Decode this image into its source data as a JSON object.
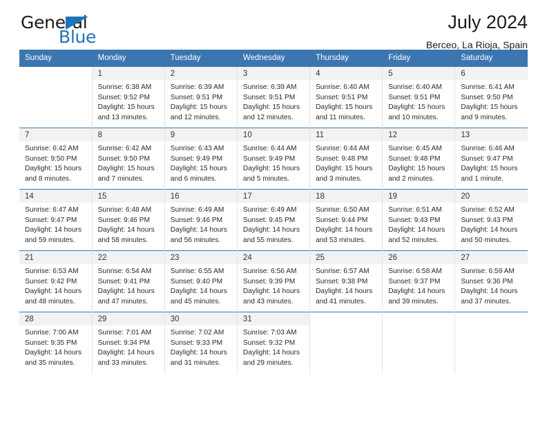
{
  "brand": {
    "name_part1": "General",
    "name_part2": "Blue",
    "accent_color": "#1e74bb"
  },
  "header": {
    "title": "July 2024",
    "subtitle": "Berceo, La Rioja, Spain"
  },
  "calendar": {
    "header_color": "#3b76b0",
    "weekday_headers": [
      "Sunday",
      "Monday",
      "Tuesday",
      "Wednesday",
      "Thursday",
      "Friday",
      "Saturday"
    ],
    "weeks": [
      [
        {
          "day": "",
          "lines": []
        },
        {
          "day": "1",
          "lines": [
            "Sunrise: 6:38 AM",
            "Sunset: 9:52 PM",
            "Daylight: 15 hours",
            "and 13 minutes."
          ]
        },
        {
          "day": "2",
          "lines": [
            "Sunrise: 6:39 AM",
            "Sunset: 9:51 PM",
            "Daylight: 15 hours",
            "and 12 minutes."
          ]
        },
        {
          "day": "3",
          "lines": [
            "Sunrise: 6:39 AM",
            "Sunset: 9:51 PM",
            "Daylight: 15 hours",
            "and 12 minutes."
          ]
        },
        {
          "day": "4",
          "lines": [
            "Sunrise: 6:40 AM",
            "Sunset: 9:51 PM",
            "Daylight: 15 hours",
            "and 11 minutes."
          ]
        },
        {
          "day": "5",
          "lines": [
            "Sunrise: 6:40 AM",
            "Sunset: 9:51 PM",
            "Daylight: 15 hours",
            "and 10 minutes."
          ]
        },
        {
          "day": "6",
          "lines": [
            "Sunrise: 6:41 AM",
            "Sunset: 9:50 PM",
            "Daylight: 15 hours",
            "and 9 minutes."
          ]
        }
      ],
      [
        {
          "day": "7",
          "lines": [
            "Sunrise: 6:42 AM",
            "Sunset: 9:50 PM",
            "Daylight: 15 hours",
            "and 8 minutes."
          ]
        },
        {
          "day": "8",
          "lines": [
            "Sunrise: 6:42 AM",
            "Sunset: 9:50 PM",
            "Daylight: 15 hours",
            "and 7 minutes."
          ]
        },
        {
          "day": "9",
          "lines": [
            "Sunrise: 6:43 AM",
            "Sunset: 9:49 PM",
            "Daylight: 15 hours",
            "and 6 minutes."
          ]
        },
        {
          "day": "10",
          "lines": [
            "Sunrise: 6:44 AM",
            "Sunset: 9:49 PM",
            "Daylight: 15 hours",
            "and 5 minutes."
          ]
        },
        {
          "day": "11",
          "lines": [
            "Sunrise: 6:44 AM",
            "Sunset: 9:48 PM",
            "Daylight: 15 hours",
            "and 3 minutes."
          ]
        },
        {
          "day": "12",
          "lines": [
            "Sunrise: 6:45 AM",
            "Sunset: 9:48 PM",
            "Daylight: 15 hours",
            "and 2 minutes."
          ]
        },
        {
          "day": "13",
          "lines": [
            "Sunrise: 6:46 AM",
            "Sunset: 9:47 PM",
            "Daylight: 15 hours",
            "and 1 minute."
          ]
        }
      ],
      [
        {
          "day": "14",
          "lines": [
            "Sunrise: 6:47 AM",
            "Sunset: 9:47 PM",
            "Daylight: 14 hours",
            "and 59 minutes."
          ]
        },
        {
          "day": "15",
          "lines": [
            "Sunrise: 6:48 AM",
            "Sunset: 9:46 PM",
            "Daylight: 14 hours",
            "and 58 minutes."
          ]
        },
        {
          "day": "16",
          "lines": [
            "Sunrise: 6:49 AM",
            "Sunset: 9:46 PM",
            "Daylight: 14 hours",
            "and 56 minutes."
          ]
        },
        {
          "day": "17",
          "lines": [
            "Sunrise: 6:49 AM",
            "Sunset: 9:45 PM",
            "Daylight: 14 hours",
            "and 55 minutes."
          ]
        },
        {
          "day": "18",
          "lines": [
            "Sunrise: 6:50 AM",
            "Sunset: 9:44 PM",
            "Daylight: 14 hours",
            "and 53 minutes."
          ]
        },
        {
          "day": "19",
          "lines": [
            "Sunrise: 6:51 AM",
            "Sunset: 9:43 PM",
            "Daylight: 14 hours",
            "and 52 minutes."
          ]
        },
        {
          "day": "20",
          "lines": [
            "Sunrise: 6:52 AM",
            "Sunset: 9:43 PM",
            "Daylight: 14 hours",
            "and 50 minutes."
          ]
        }
      ],
      [
        {
          "day": "21",
          "lines": [
            "Sunrise: 6:53 AM",
            "Sunset: 9:42 PM",
            "Daylight: 14 hours",
            "and 48 minutes."
          ]
        },
        {
          "day": "22",
          "lines": [
            "Sunrise: 6:54 AM",
            "Sunset: 9:41 PM",
            "Daylight: 14 hours",
            "and 47 minutes."
          ]
        },
        {
          "day": "23",
          "lines": [
            "Sunrise: 6:55 AM",
            "Sunset: 9:40 PM",
            "Daylight: 14 hours",
            "and 45 minutes."
          ]
        },
        {
          "day": "24",
          "lines": [
            "Sunrise: 6:56 AM",
            "Sunset: 9:39 PM",
            "Daylight: 14 hours",
            "and 43 minutes."
          ]
        },
        {
          "day": "25",
          "lines": [
            "Sunrise: 6:57 AM",
            "Sunset: 9:38 PM",
            "Daylight: 14 hours",
            "and 41 minutes."
          ]
        },
        {
          "day": "26",
          "lines": [
            "Sunrise: 6:58 AM",
            "Sunset: 9:37 PM",
            "Daylight: 14 hours",
            "and 39 minutes."
          ]
        },
        {
          "day": "27",
          "lines": [
            "Sunrise: 6:59 AM",
            "Sunset: 9:36 PM",
            "Daylight: 14 hours",
            "and 37 minutes."
          ]
        }
      ],
      [
        {
          "day": "28",
          "lines": [
            "Sunrise: 7:00 AM",
            "Sunset: 9:35 PM",
            "Daylight: 14 hours",
            "and 35 minutes."
          ]
        },
        {
          "day": "29",
          "lines": [
            "Sunrise: 7:01 AM",
            "Sunset: 9:34 PM",
            "Daylight: 14 hours",
            "and 33 minutes."
          ]
        },
        {
          "day": "30",
          "lines": [
            "Sunrise: 7:02 AM",
            "Sunset: 9:33 PM",
            "Daylight: 14 hours",
            "and 31 minutes."
          ]
        },
        {
          "day": "31",
          "lines": [
            "Sunrise: 7:03 AM",
            "Sunset: 9:32 PM",
            "Daylight: 14 hours",
            "and 29 minutes."
          ]
        },
        {
          "day": "",
          "lines": []
        },
        {
          "day": "",
          "lines": []
        },
        {
          "day": "",
          "lines": []
        }
      ]
    ]
  }
}
